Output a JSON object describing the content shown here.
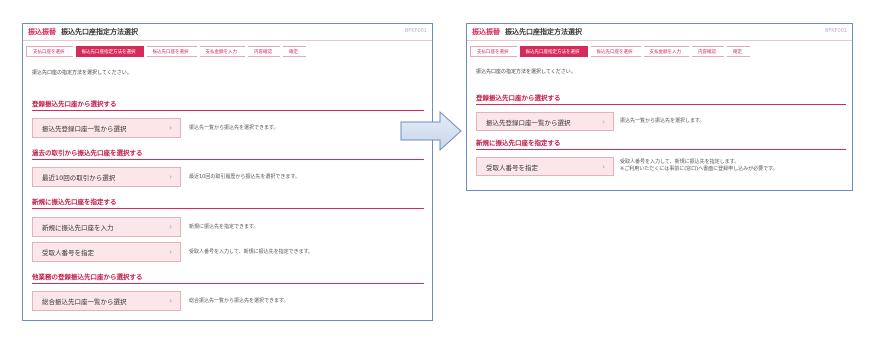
{
  "left": {
    "header": {
      "tag": "振込振替",
      "title": "振込先口座指定方法選択",
      "code": "BFKF001"
    },
    "steps": [
      "支払口座を選択",
      "振込先口座指定方法を選択",
      "振込先口座を選択",
      "支払金額を入力",
      "内容確認",
      "確定"
    ],
    "intro": "振込先口座の指定方法を選択してください。",
    "sections": [
      {
        "title": "登録振込先口座から選択する",
        "buttons": [
          {
            "label": "振込先登録口座一覧から選択",
            "desc": "振込先一覧から振込先を選択できます。"
          }
        ]
      },
      {
        "title": "過去の取引から振込先口座を選択する",
        "buttons": [
          {
            "label": "最近10回の取引から選択",
            "desc": "最近10回の取引履歴から振込先を選択できます。"
          }
        ]
      },
      {
        "title": "新規に振込先口座を指定する",
        "buttons": [
          {
            "label": "新規に振込先口座を入力",
            "desc": "新規に振込先を指定できます。"
          },
          {
            "label": "受取人番号を指定",
            "desc": "受取人番号を入力して、新規に振込先を指定できます。"
          }
        ]
      },
      {
        "title": "他業務の登録振込先口座から選択する",
        "buttons": [
          {
            "label": "総合振込先口座一覧から選択",
            "desc": "総合振込先一覧から振込先を選択できます。"
          }
        ]
      }
    ]
  },
  "right": {
    "header": {
      "tag": "振込振替",
      "title": "振込先口座指定方法選択",
      "code": "BFKF001"
    },
    "steps": [
      "支払口座を選択",
      "振込先口座指定方法を選択",
      "振込先口座を選択",
      "支払金額を入力",
      "内容確認",
      "確定"
    ],
    "intro": "振込先口座の指定方法を選択してください。",
    "sections": [
      {
        "title": "登録振込先口座から選択する",
        "buttons": [
          {
            "label": "振込先登録口座一覧から選択",
            "desc": "振込先一覧から振込先を選択します。"
          }
        ]
      },
      {
        "title": "新規に振込先口座を指定する",
        "buttons": [
          {
            "label": "受取人番号を指定",
            "desc": "受取人番号を入力して、新規に振込先を指定します。",
            "desc2": "※ご利用いただくには事前に(窓口)へ書面に登録申し込みが必要です。"
          }
        ]
      }
    ]
  },
  "chevron": "›",
  "colors": {
    "accent": "#d62b5a",
    "button_bg": "#fbe6ea",
    "frame": "#6b8fc4"
  }
}
